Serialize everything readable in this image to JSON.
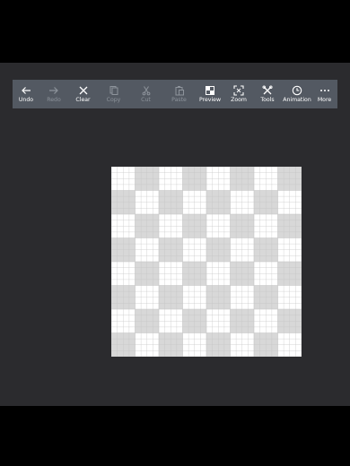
{
  "toolbar": {
    "items": [
      {
        "label": "Undo",
        "icon": "arrow-left-icon",
        "enabled": true
      },
      {
        "label": "Redo",
        "icon": "arrow-right-icon",
        "enabled": false
      },
      {
        "label": "Clear",
        "icon": "x-icon",
        "enabled": true
      },
      {
        "label": "Copy",
        "icon": "copy-icon",
        "enabled": false
      },
      {
        "label": "Cut",
        "icon": "scissors-icon",
        "enabled": false
      },
      {
        "label": "Paste",
        "icon": "paste-icon",
        "enabled": false
      },
      {
        "label": "Preview",
        "icon": "preview-icon",
        "enabled": true
      },
      {
        "label": "Zoom",
        "icon": "zoom-icon",
        "enabled": true
      },
      {
        "label": "Tools",
        "icon": "tools-icon",
        "enabled": true
      },
      {
        "label": "Animation",
        "icon": "clock-icon",
        "enabled": true
      },
      {
        "label": "More",
        "icon": "more-icon",
        "enabled": true
      }
    ]
  },
  "canvas": {
    "checker_light": "#ffffff",
    "checker_dark": "#d8d8d8",
    "gridline_color": "#c4c4c4",
    "background": "#2b2b2e",
    "toolbar_color": "#535962"
  }
}
